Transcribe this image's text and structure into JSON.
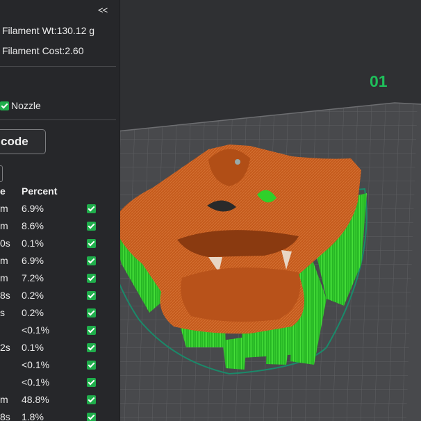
{
  "panel": {
    "collapse_label": "<<",
    "filament_weight": "Filament Wt:130.12 g",
    "filament_cost": "Filament Cost:2.60",
    "nozzle_label": "Nozzle",
    "gcode_button": "code",
    "columns": {
      "time": "e",
      "percent": "Percent"
    },
    "rows": [
      {
        "time": "m",
        "percent": "6.9%"
      },
      {
        "time": "m",
        "percent": "8.6%"
      },
      {
        "time": "0s",
        "percent": "0.1%"
      },
      {
        "time": "m",
        "percent": "6.9%"
      },
      {
        "time": "m",
        "percent": "7.2%"
      },
      {
        "time": "8s",
        "percent": "0.2%"
      },
      {
        "time": "s",
        "percent": "0.2%"
      },
      {
        "time": "",
        "percent": "<0.1%"
      },
      {
        "time": "2s",
        "percent": "0.1%"
      },
      {
        "time": "",
        "percent": "<0.1%"
      },
      {
        "time": "",
        "percent": "<0.1%"
      },
      {
        "time": "m",
        "percent": "48.8%"
      },
      {
        "time": "8s",
        "percent": "1.8%"
      }
    ]
  },
  "viewport": {
    "plate_number": "01",
    "colors": {
      "model": "#c2571b",
      "support": "#2fd02a",
      "plate": "#4a4b4e",
      "grid": "#5e5f62",
      "skirt": "#1a8a6a",
      "accent": "#1fbe5a"
    }
  }
}
